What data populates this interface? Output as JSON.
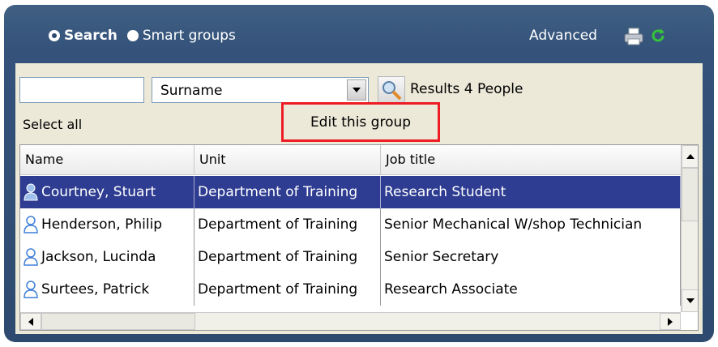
{
  "header": {
    "search_label": "Search",
    "smart_groups_label": "Smart groups",
    "advanced_label": "Advanced",
    "icons": [
      "printer-icon",
      "refresh-icon"
    ]
  },
  "toolbar": {
    "search_value": "",
    "field_select": "Surname",
    "results_label": "Results 4 People"
  },
  "actions": {
    "select_all": "Select all",
    "edit_group": "Edit this group"
  },
  "grid": {
    "columns": [
      "Name",
      "Unit",
      "Job title"
    ],
    "rows": [
      {
        "name": "Courtney, Stuart",
        "unit": "Department of Training",
        "job": "Research Student",
        "selected": true
      },
      {
        "name": "Henderson, Philip",
        "unit": "Department of Training",
        "job": "Senior Mechanical W/shop Technician",
        "selected": false
      },
      {
        "name": "Jackson, Lucinda",
        "unit": "Department of Training",
        "job": "Senior Secretary",
        "selected": false
      },
      {
        "name": "Surtees, Patrick",
        "unit": "Department of Training",
        "job": "Research Associate",
        "selected": false
      }
    ]
  },
  "colors": {
    "panel": "#34527a",
    "selection": "#2e3c91",
    "highlight": "#ee1c24"
  }
}
